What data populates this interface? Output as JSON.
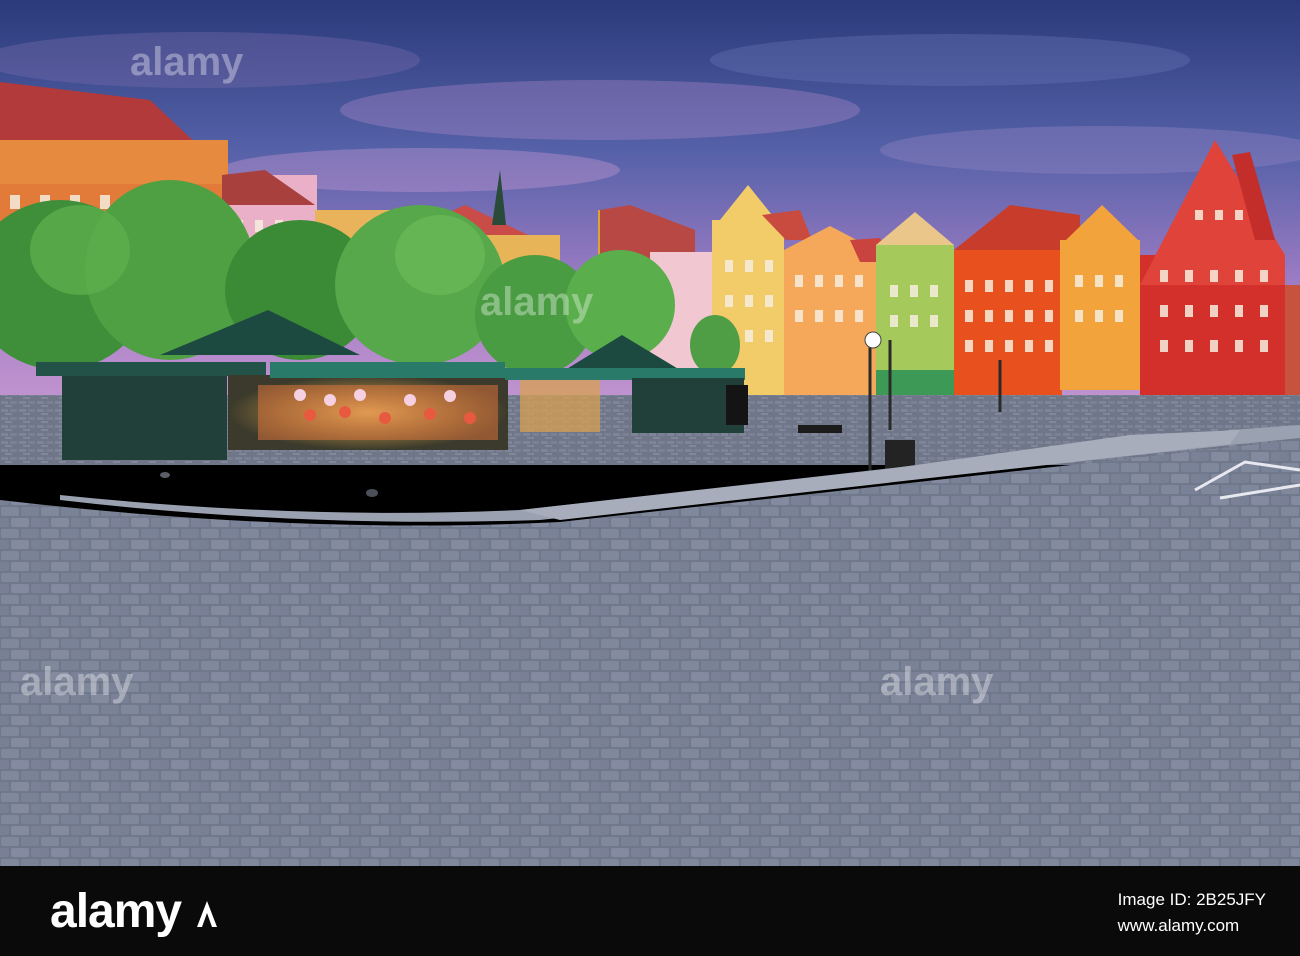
{
  "footer": {
    "brand": "alamy",
    "image_id": "Image ID: 2B25JFY",
    "url": "www.alamy.com"
  },
  "watermark": {
    "text": "alamy"
  }
}
